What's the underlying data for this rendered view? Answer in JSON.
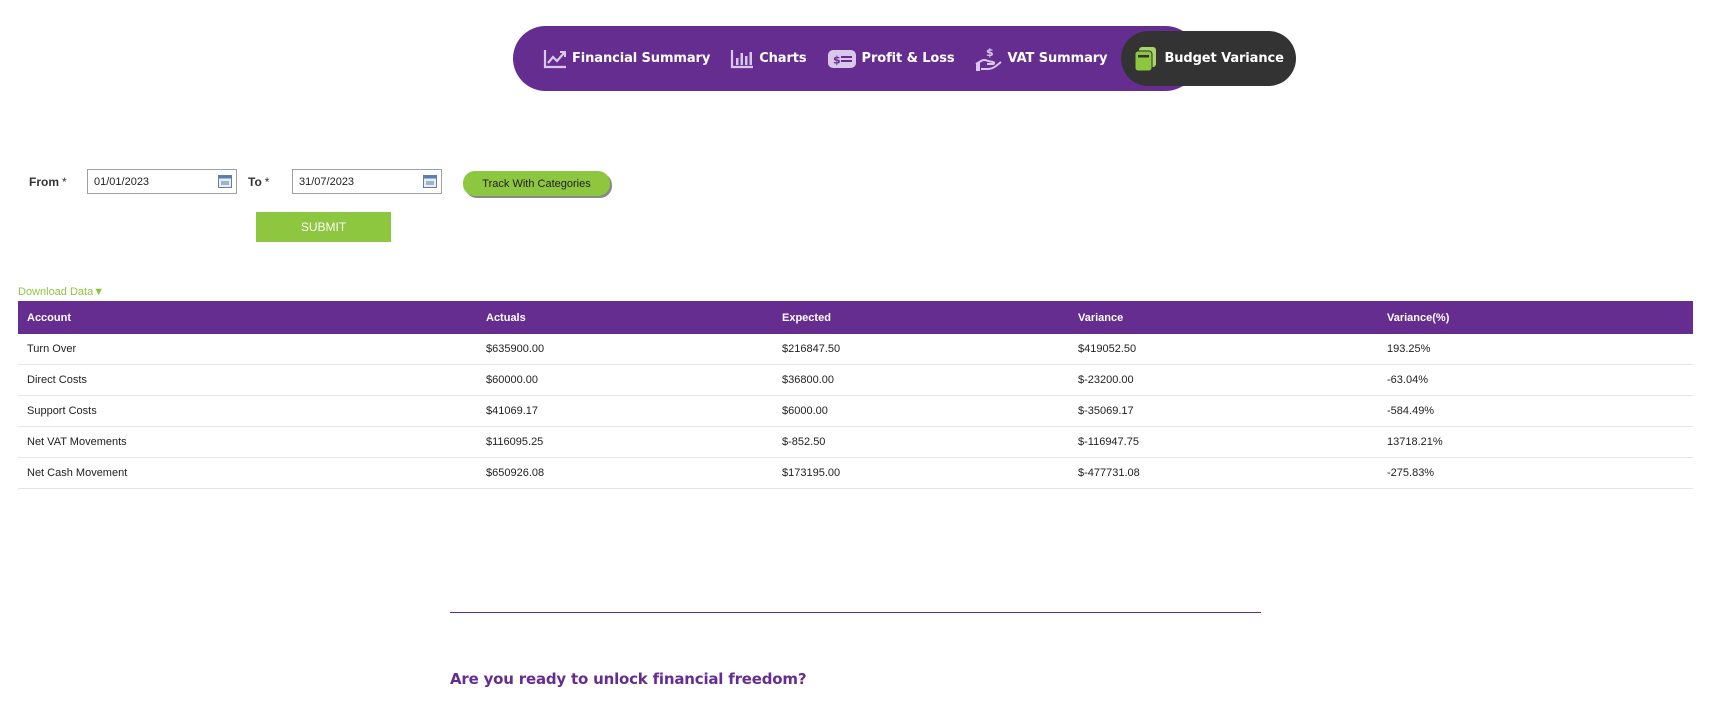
{
  "nav": {
    "items": [
      {
        "label": "Financial Summary",
        "icon": "chart-line-icon"
      },
      {
        "label": "Charts",
        "icon": "bar-chart-icon"
      },
      {
        "label": "Profit & Loss",
        "icon": "money-bill-icon"
      },
      {
        "label": "VAT Summary",
        "icon": "hand-dollar-icon"
      },
      {
        "label": "Budget Variance",
        "icon": "wallet-icon",
        "active": true
      }
    ],
    "colors": {
      "bar": "#662d91",
      "active": "#333333",
      "accent": "#8dc63f"
    }
  },
  "filters": {
    "from_label": "From",
    "from_required": "*",
    "from_value": "01/01/2023",
    "to_label": "To",
    "to_required": "*",
    "to_value": "31/07/2023",
    "track_label": "Track With Categories",
    "submit_label": "SUBMIT"
  },
  "download": {
    "label": "Download Data",
    "arrow": "▼"
  },
  "table": {
    "columns": [
      "Account",
      "Actuals",
      "Expected",
      "Variance",
      "Variance(%)"
    ],
    "rows": [
      [
        "Turn Over",
        "$635900.00",
        "$216847.50",
        "$419052.50",
        "193.25%"
      ],
      [
        "Direct Costs",
        "$60000.00",
        "$36800.00",
        "$-23200.00",
        "-63.04%"
      ],
      [
        "Support Costs",
        "$41069.17",
        "$6000.00",
        "$-35069.17",
        "-584.49%"
      ],
      [
        "Net VAT Movements",
        "$116095.25",
        "$-852.50",
        "$-116947.75",
        "13718.21%"
      ],
      [
        "Net Cash Movement",
        "$650926.08",
        "$173195.00",
        "$-477731.08",
        "-275.83%"
      ]
    ]
  },
  "footer": {
    "cta": "Are you ready to unlock financial freedom?"
  }
}
